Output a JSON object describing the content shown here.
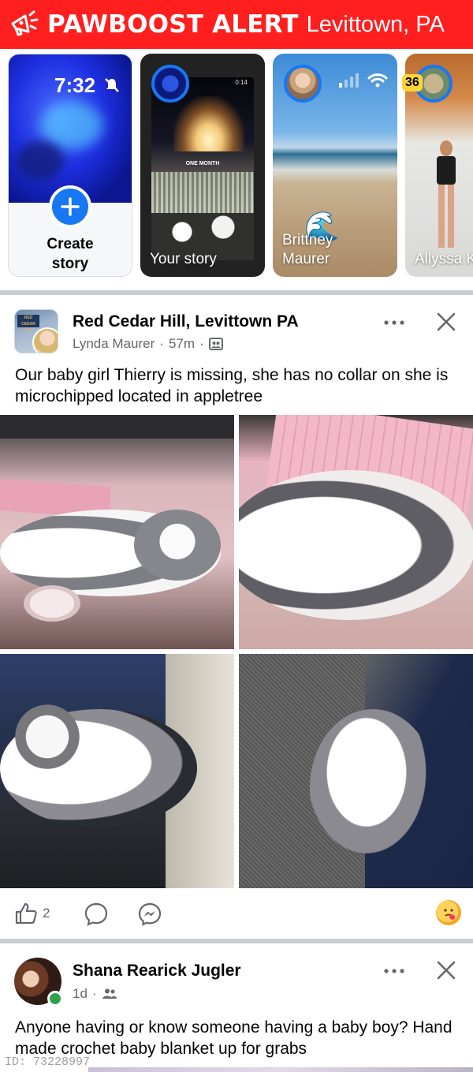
{
  "alert": {
    "title": "PAWBOOST ALERT",
    "location": "Levittown, PA"
  },
  "stories": {
    "create": {
      "time": "7:32",
      "label_line1": "Create",
      "label_line2": "story"
    },
    "items": [
      {
        "name": "Your story",
        "overlay_text": "ONE MONTH",
        "duration": "0:14"
      },
      {
        "name_line1": "Brittney",
        "name_line2": "Maurer"
      },
      {
        "name": "Allyssa K"
      }
    ],
    "battery": "36"
  },
  "post1": {
    "group": "Red Cedar Hill, Levittown PA",
    "author": "Lynda Maurer",
    "time": "57m",
    "text": "Our baby girl Thierry is missing, she has no collar on she is microchipped located in appletree",
    "likes": "2",
    "group_sign": "RED CEDAR HILL"
  },
  "post2": {
    "author": "Shana Rearick Jugler",
    "time": "1d",
    "text": "Anyone having or know someone having a baby boy? Hand made crochet baby blanket up for grabs"
  },
  "footer": {
    "id": "ID: 73228997"
  },
  "colors": {
    "alert_red": "#ff1f1f",
    "fb_blue": "#1877f2",
    "meta_grey": "#65676b",
    "online_green": "#31a24c"
  }
}
